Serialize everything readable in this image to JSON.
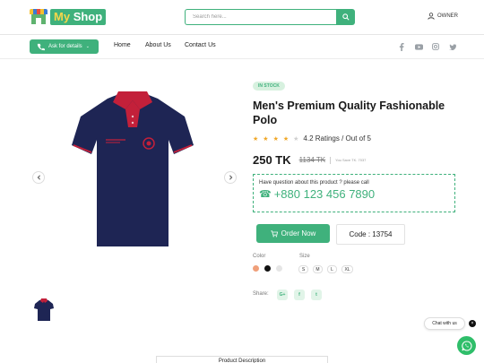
{
  "header": {
    "logo": {
      "prefix": "My",
      "suffix": "Shop"
    },
    "search_placeholder": "Search here...",
    "search_icon": "search-icon",
    "owner_label": "OWNER",
    "owner_icon": "user-icon"
  },
  "nav": {
    "ask_button": "Ask for details",
    "links": [
      "Home",
      "About Us",
      "Contact Us"
    ],
    "social_icons": [
      "facebook-icon",
      "youtube-icon",
      "instagram-icon",
      "twitter-icon"
    ]
  },
  "product": {
    "stock_badge": "IN STOCK",
    "title": "Men's Premium Quality Fashionable Polo",
    "rating": {
      "stars": 4,
      "max": 5,
      "text": "4.2 Ratings / Out of 5"
    },
    "price": "250 TK",
    "old_price": "1134 TK",
    "save_text": "You Save TK. 7037",
    "question_text": "Have question about this product ? please call",
    "phone": "+880 123 456 7890",
    "order_button": "Order Now",
    "code_text": "Code : 13754",
    "color_label": "Color",
    "colors": [
      "#f0a07a",
      "#111111",
      "#e5e5e5"
    ],
    "size_label": "Size",
    "sizes": [
      "S",
      "M",
      "L",
      "XL"
    ],
    "share_label": "Share:",
    "share_icons": [
      "G+",
      "f",
      "t"
    ],
    "shirt_color": "#1e2554",
    "collar_color": "#c3203a"
  },
  "footer": {
    "description_tab": "Product Description",
    "chat_label": "Chat with us",
    "chat_close": "×"
  },
  "colors": {
    "accent": "#3fb17c"
  }
}
